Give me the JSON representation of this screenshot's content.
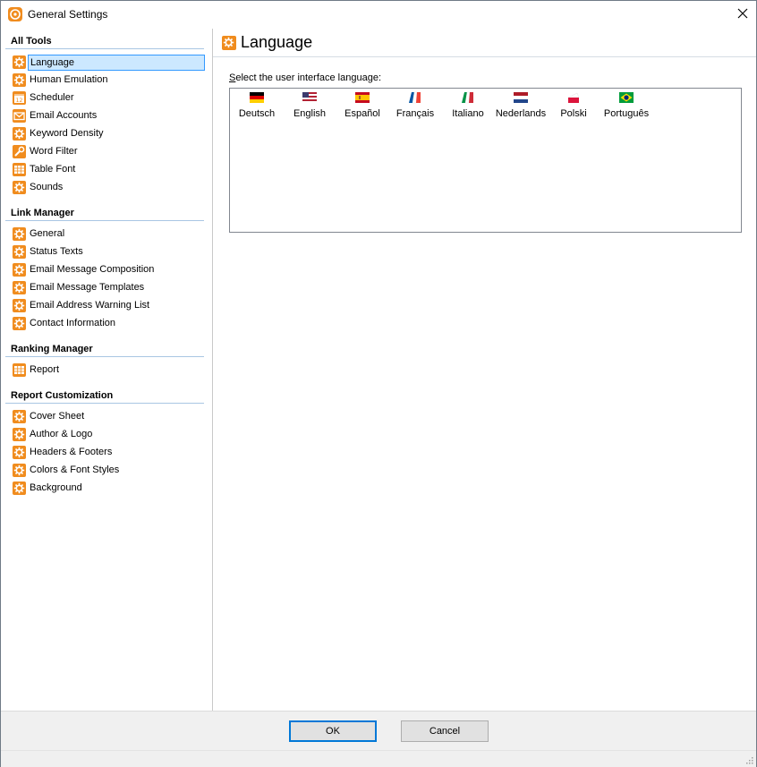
{
  "window": {
    "title": "General Settings",
    "close_glyph": "✕"
  },
  "sidebar": {
    "groups": [
      {
        "title": "All Tools",
        "items": [
          {
            "label": "Language",
            "icon": "gear-icon",
            "selected": true
          },
          {
            "label": "Human Emulation",
            "icon": "gear-icon"
          },
          {
            "label": "Scheduler",
            "icon": "calendar-icon"
          },
          {
            "label": "Email Accounts",
            "icon": "envelope-icon"
          },
          {
            "label": "Keyword Density",
            "icon": "gear-icon"
          },
          {
            "label": "Word Filter",
            "icon": "wrench-icon"
          },
          {
            "label": "Table Font",
            "icon": "table-icon"
          },
          {
            "label": "Sounds",
            "icon": "gear-icon"
          }
        ]
      },
      {
        "title": "Link Manager",
        "items": [
          {
            "label": "General",
            "icon": "gear-icon"
          },
          {
            "label": "Status Texts",
            "icon": "gear-icon"
          },
          {
            "label": "Email Message Composition",
            "icon": "gear-icon"
          },
          {
            "label": "Email Message Templates",
            "icon": "gear-icon"
          },
          {
            "label": "Email Address Warning List",
            "icon": "gear-icon"
          },
          {
            "label": "Contact Information",
            "icon": "gear-icon"
          }
        ]
      },
      {
        "title": "Ranking Manager",
        "items": [
          {
            "label": "Report",
            "icon": "table-icon"
          }
        ]
      },
      {
        "title": "Report Customization",
        "items": [
          {
            "label": "Cover Sheet",
            "icon": "gear-icon"
          },
          {
            "label": "Author & Logo",
            "icon": "gear-icon"
          },
          {
            "label": "Headers & Footers",
            "icon": "gear-icon"
          },
          {
            "label": "Colors & Font Styles",
            "icon": "gear-icon"
          },
          {
            "label": "Background",
            "icon": "gear-icon"
          }
        ]
      }
    ]
  },
  "main": {
    "title": "Language",
    "prompt_first": "S",
    "prompt_rest": "elect the user interface language:",
    "languages": [
      {
        "name": "Deutsch",
        "flag": "germany-flag-icon"
      },
      {
        "name": "English",
        "flag": "usa-flag-icon"
      },
      {
        "name": "Español",
        "flag": "spain-flag-icon"
      },
      {
        "name": "Français",
        "flag": "france-flag-icon"
      },
      {
        "name": "Italiano",
        "flag": "italy-flag-icon"
      },
      {
        "name": "Nederlands",
        "flag": "netherlands-flag-icon"
      },
      {
        "name": "Polski",
        "flag": "poland-flag-icon"
      },
      {
        "name": "Português",
        "flag": "brazil-flag-icon"
      }
    ]
  },
  "footer": {
    "ok_label": "OK",
    "cancel_label": "Cancel"
  },
  "colors": {
    "accent": "#f08c1e",
    "selection": "#cce8ff",
    "selection_border": "#3399ff",
    "default_button_border": "#0078d7"
  }
}
